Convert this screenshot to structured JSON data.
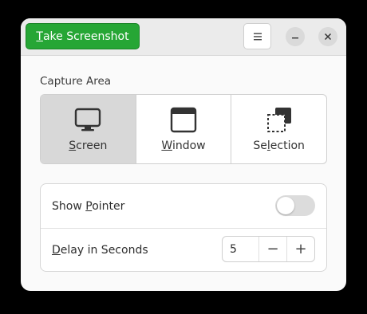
{
  "header": {
    "take_screenshot_label": "Take Screenshot",
    "take_screenshot_mnemonic": "T",
    "take_screenshot_rest": "ake Screenshot"
  },
  "capture_area": {
    "label": "Capture Area",
    "options": [
      {
        "label": "Screen",
        "mnemonic": "S",
        "rest": "creen",
        "icon": "monitor-icon",
        "selected": true
      },
      {
        "label": "Window",
        "mnemonic": "W",
        "rest": "indow",
        "icon": "window-icon",
        "selected": false
      },
      {
        "label": "Selection",
        "prefix": "Se",
        "mnemonic": "l",
        "rest": "ection",
        "icon": "selection-icon",
        "selected": false
      }
    ]
  },
  "options": {
    "show_pointer": {
      "label": "Show Pointer",
      "prefix": "Show ",
      "mnemonic": "P",
      "rest": "ointer",
      "enabled": false
    },
    "delay": {
      "label": "Delay in Seconds",
      "mnemonic": "D",
      "rest": "elay in Seconds",
      "value": "5",
      "minus": "−",
      "plus": "+"
    }
  },
  "colors": {
    "accent": "#26a635",
    "selected_bg": "#d8d8d8"
  }
}
